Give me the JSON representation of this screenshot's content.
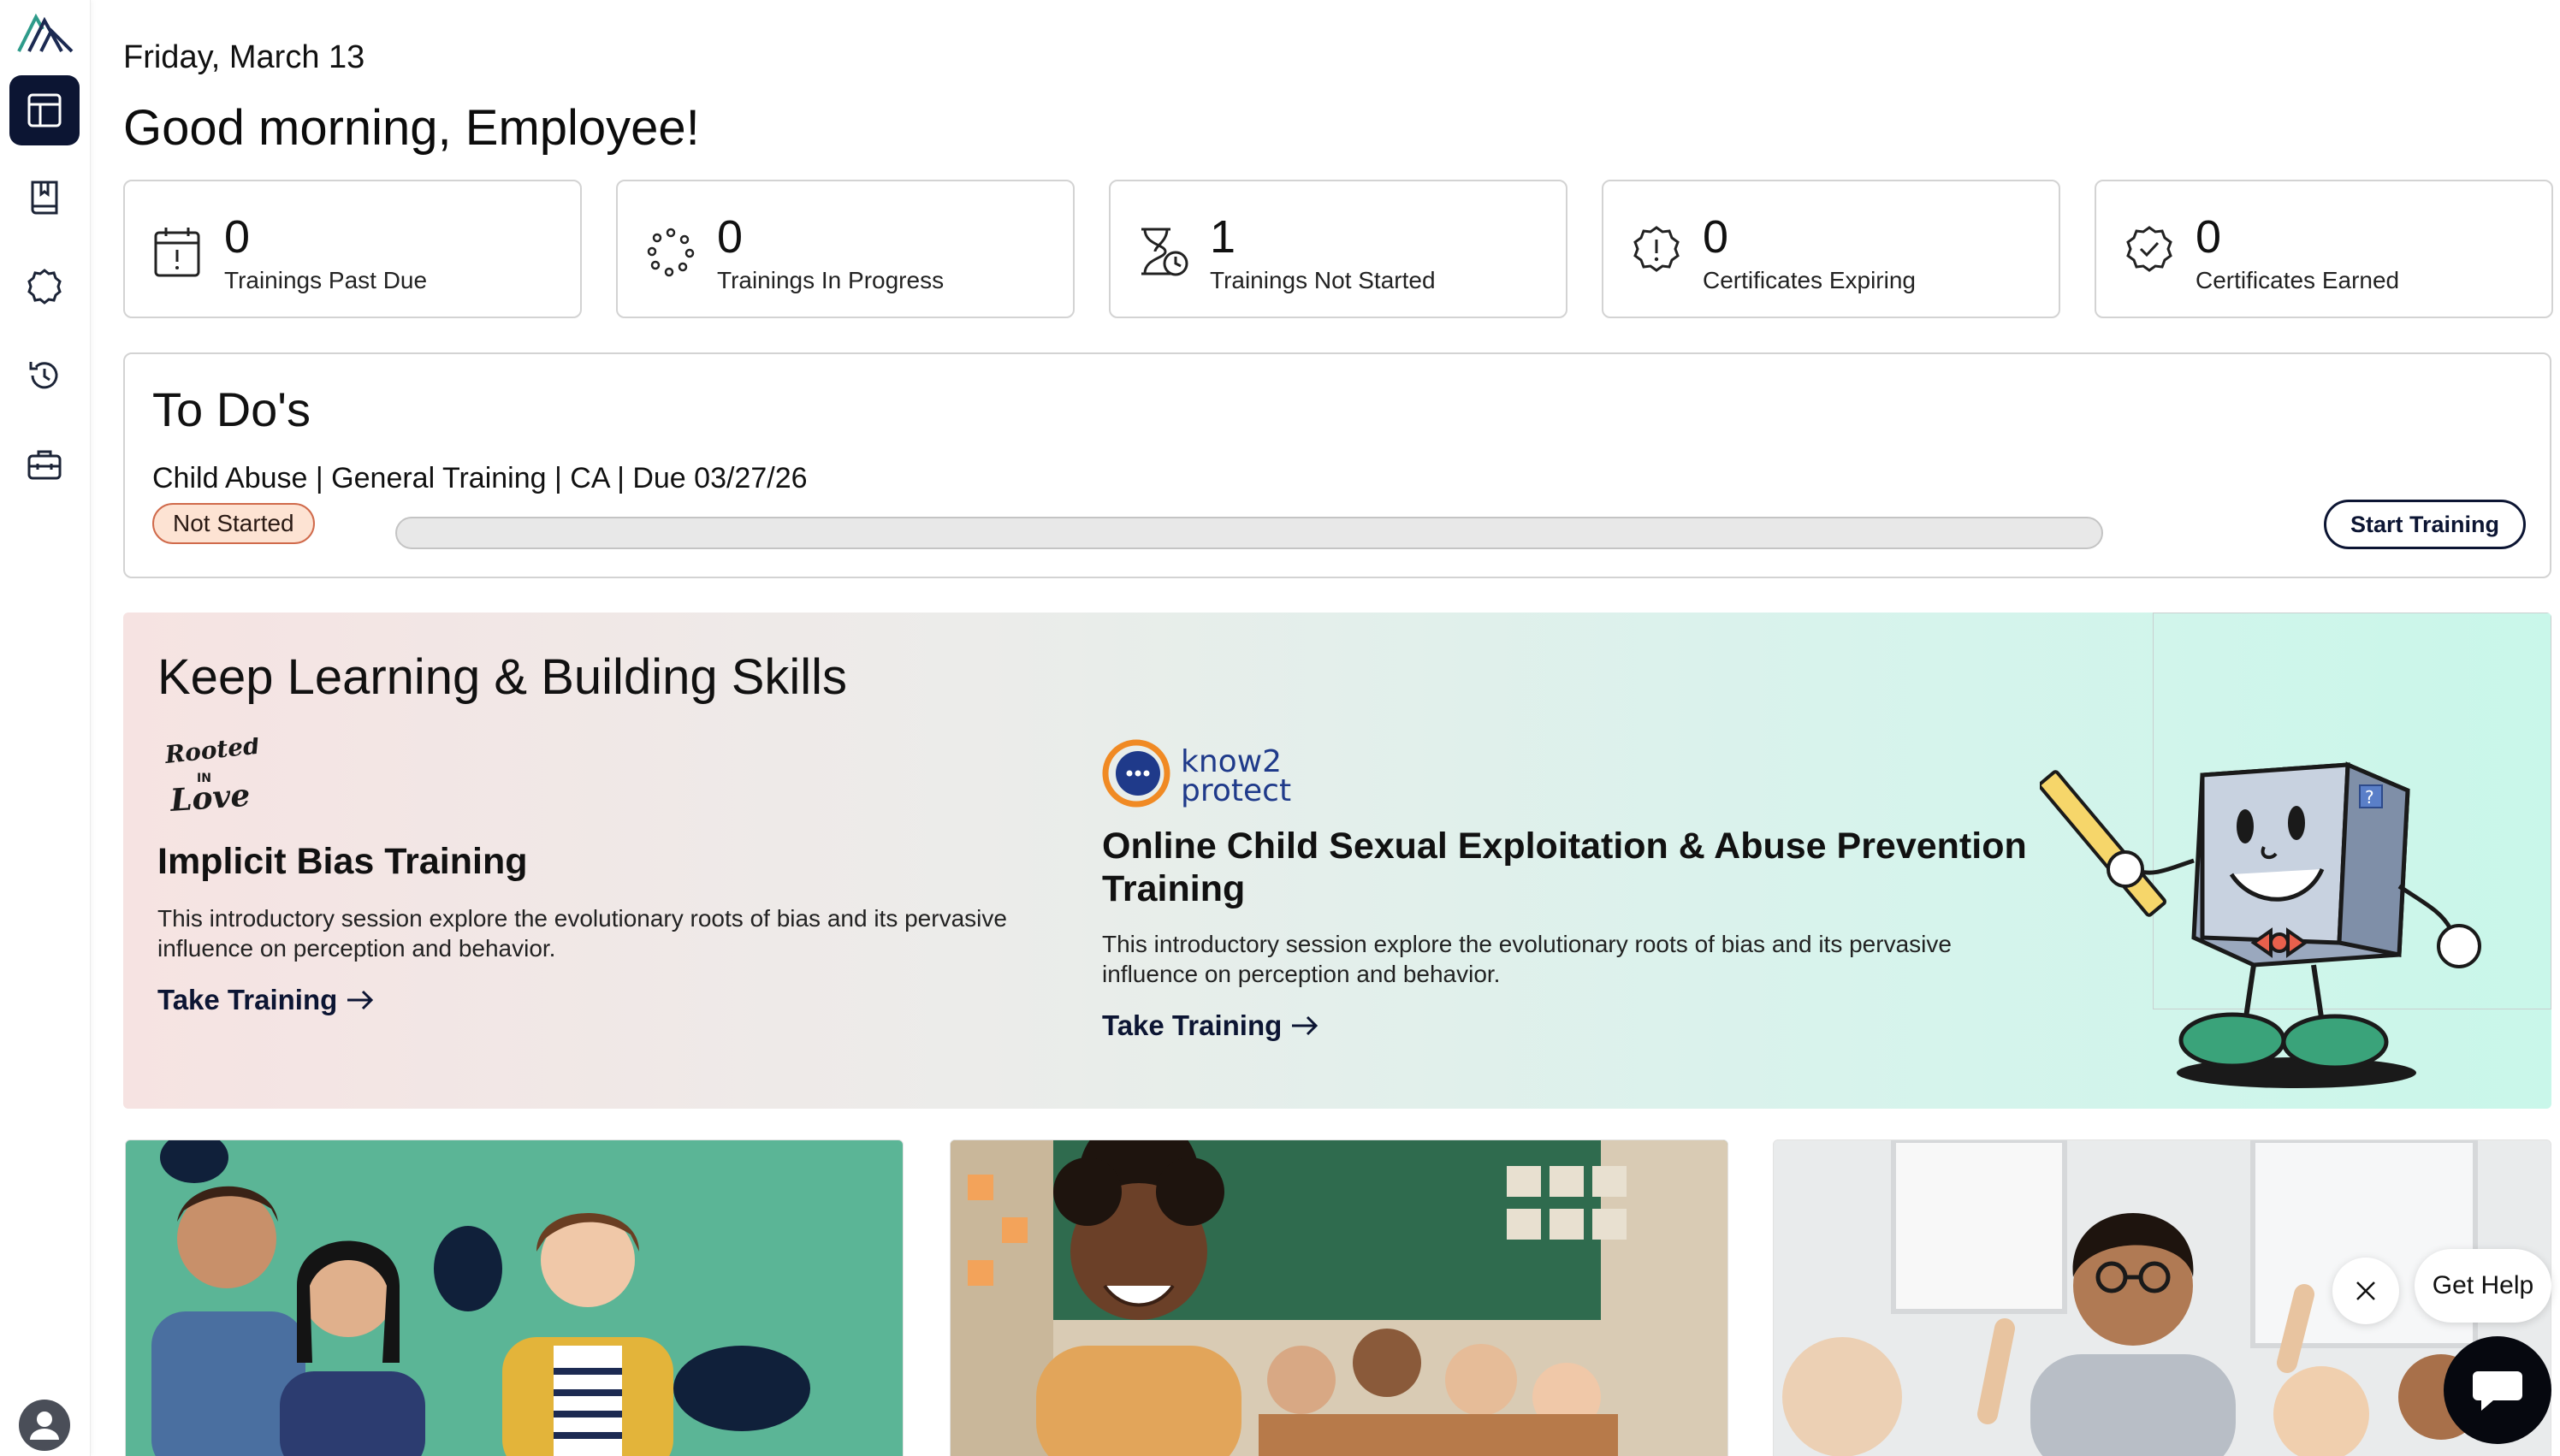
{
  "header": {
    "date": "Friday, March 13",
    "greeting": "Good morning, Employee!"
  },
  "sidebar": {
    "items": [
      {
        "icon": "dashboard-icon",
        "active": true
      },
      {
        "icon": "book-icon",
        "active": false
      },
      {
        "icon": "badge-icon",
        "active": false
      },
      {
        "icon": "history-icon",
        "active": false
      },
      {
        "icon": "toolbox-icon",
        "active": false
      }
    ]
  },
  "stats": [
    {
      "value": "0",
      "label": "Trainings Past Due",
      "icon": "calendar-alert-icon"
    },
    {
      "value": "0",
      "label": "Trainings In Progress",
      "icon": "loading-dots-icon"
    },
    {
      "value": "1",
      "label": "Trainings Not Started",
      "icon": "hourglass-clock-icon"
    },
    {
      "value": "0",
      "label": "Certificates Expiring",
      "icon": "badge-alert-icon"
    },
    {
      "value": "0",
      "label": "Certificates Earned",
      "icon": "badge-check-icon"
    }
  ],
  "todo": {
    "title": "To Do's",
    "item": "Child Abuse | General Training | CA | Due 03/27/26",
    "status": "Not Started",
    "progress": 0,
    "button": "Start Training"
  },
  "promo": {
    "title": "Keep Learning & Building Skills",
    "courses": [
      {
        "logo": "Rooted in Love",
        "title": "Implicit Bias Training",
        "description": "This introductory session explore the evolutionary roots of bias and its pervasive influence on perception and behavior.",
        "link": "Take Training"
      },
      {
        "logo": "know2 protect",
        "title": "Online Child Sexual Exploitation & Abuse Prevention Training",
        "description": "This introductory session explore the evolutionary roots of bias and its pervasive influence on perception and behavior.",
        "link": "Take Training"
      }
    ],
    "mascot_flag": "?"
  },
  "help": {
    "label": "Get Help"
  },
  "colors": {
    "navy": "#0c1533",
    "badge_bg": "#fde3d3",
    "badge_border": "#d06a4b",
    "teal_card": "#5bb596"
  }
}
